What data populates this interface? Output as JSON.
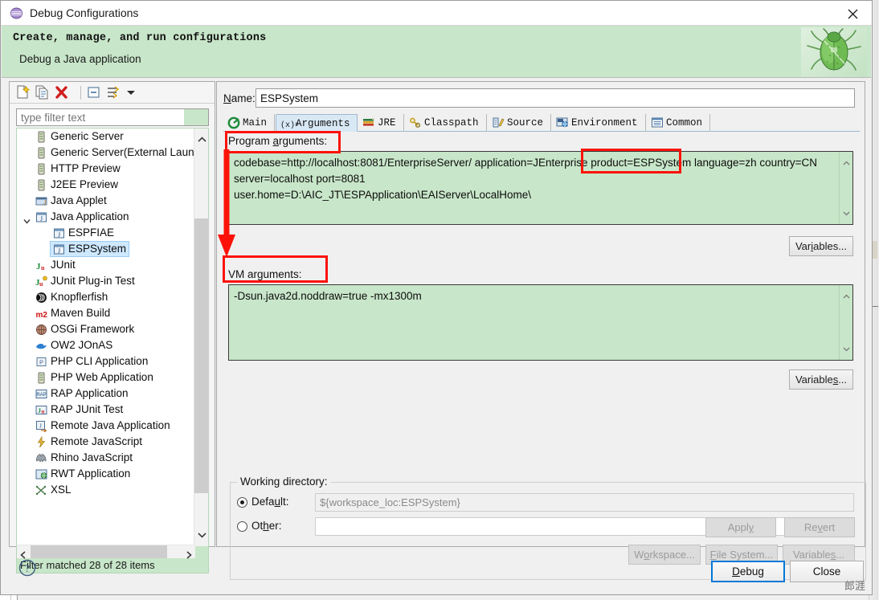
{
  "window": {
    "title": "Debug Configurations",
    "icon": "debug-configurations-icon",
    "close_label": "✕"
  },
  "header": {
    "title": "Create, manage, and run configurations",
    "subtitle": "Debug a Java application",
    "image": "green-bug-icon"
  },
  "left_panel": {
    "toolbar": [
      {
        "name": "new-launch-configuration-icon",
        "tooltip": "New launch configuration"
      },
      {
        "name": "duplicate-icon",
        "tooltip": "Duplicate"
      },
      {
        "name": "delete-icon",
        "tooltip": "Delete"
      },
      {
        "name": "collapse-all-icon",
        "tooltip": "Collapse All"
      },
      {
        "name": "filter-icon",
        "tooltip": "Filter"
      },
      {
        "name": "chevron-down-icon",
        "tooltip": "Menu"
      }
    ],
    "filter": {
      "value": "",
      "placeholder": "type filter text"
    },
    "tree": [
      {
        "label": "Generic Server",
        "icon": "server-icon",
        "level": 1,
        "selected": false,
        "expandable": false
      },
      {
        "label": "Generic Server(External Launch)",
        "icon": "server-icon",
        "level": 1,
        "selected": false,
        "expandable": false
      },
      {
        "label": "HTTP Preview",
        "icon": "server-icon",
        "level": 1,
        "selected": false,
        "expandable": false
      },
      {
        "label": "J2EE Preview",
        "icon": "server-icon",
        "level": 1,
        "selected": false,
        "expandable": false
      },
      {
        "label": "Java Applet",
        "icon": "java-applet-icon",
        "level": 1,
        "selected": false,
        "expandable": false
      },
      {
        "label": "Java Application",
        "icon": "java-application-icon",
        "level": 1,
        "selected": false,
        "expandable": true,
        "expanded": true
      },
      {
        "label": "ESPFIAE",
        "icon": "java-config-icon",
        "level": 2,
        "selected": false,
        "expandable": false
      },
      {
        "label": "ESPSystem",
        "icon": "java-config-icon",
        "level": 2,
        "selected": true,
        "expandable": false
      },
      {
        "label": "JUnit",
        "icon": "junit-icon",
        "level": 1,
        "selected": false,
        "expandable": false
      },
      {
        "label": "JUnit Plug-in Test",
        "icon": "junit-plugin-icon",
        "level": 1,
        "selected": false,
        "expandable": false
      },
      {
        "label": "Knopflerfish",
        "icon": "knopflerfish-icon",
        "level": 1,
        "selected": false,
        "expandable": false
      },
      {
        "label": "Maven Build",
        "icon": "maven-icon",
        "level": 1,
        "selected": false,
        "expandable": false
      },
      {
        "label": "OSGi Framework",
        "icon": "osgi-icon",
        "level": 1,
        "selected": false,
        "expandable": false
      },
      {
        "label": "OW2 JOnAS",
        "icon": "jonas-icon",
        "level": 1,
        "selected": false,
        "expandable": false
      },
      {
        "label": "PHP CLI Application",
        "icon": "php-cli-icon",
        "level": 1,
        "selected": false,
        "expandable": false
      },
      {
        "label": "PHP Web Application",
        "icon": "php-web-icon",
        "level": 1,
        "selected": false,
        "expandable": false
      },
      {
        "label": "RAP Application",
        "icon": "rap-icon",
        "level": 1,
        "selected": false,
        "expandable": false
      },
      {
        "label": "RAP JUnit Test",
        "icon": "rap-junit-icon",
        "level": 1,
        "selected": false,
        "expandable": false
      },
      {
        "label": "Remote Java Application",
        "icon": "remote-java-icon",
        "level": 1,
        "selected": false,
        "expandable": false
      },
      {
        "label": "Remote JavaScript",
        "icon": "remote-javascript-icon",
        "level": 1,
        "selected": false,
        "expandable": false
      },
      {
        "label": "Rhino JavaScript",
        "icon": "rhino-icon",
        "level": 1,
        "selected": false,
        "expandable": false
      },
      {
        "label": "RWT Application",
        "icon": "rwt-icon",
        "level": 1,
        "selected": false,
        "expandable": false
      },
      {
        "label": "XSL",
        "icon": "xsl-icon",
        "level": 1,
        "selected": false,
        "expandable": false
      }
    ],
    "status": "Filter matched 28 of 28 items"
  },
  "right_panel": {
    "name_label": "Name:",
    "name_value": "ESPSystem",
    "tabs": [
      {
        "label": "Main",
        "icon": "main-tab-icon",
        "active": false
      },
      {
        "label": "Arguments",
        "icon": "arguments-tab-icon",
        "active": true
      },
      {
        "label": "JRE",
        "icon": "jre-tab-icon",
        "active": false
      },
      {
        "label": "Classpath",
        "icon": "classpath-tab-icon",
        "active": false
      },
      {
        "label": "Source",
        "icon": "source-tab-icon",
        "active": false
      },
      {
        "label": "Environment",
        "icon": "environment-tab-icon",
        "active": false
      },
      {
        "label": "Common",
        "icon": "common-tab-icon",
        "active": false
      }
    ],
    "program_arguments": {
      "label": "Program arguments:",
      "value": "codebase=http://localhost:8081/EnterpriseServer/ application=JEnterprise product=ESPSystem language=zh country=CN\nserver=localhost port=8081\nuser.home=D:\\AIC_JT\\ESPApplication\\EAIServer\\LocalHome\\",
      "variables_button": "Variables..."
    },
    "vm_arguments": {
      "label": "VM arguments:",
      "value": "-Dsun.java2d.noddraw=true -mx1300m",
      "variables_button": "Variables..."
    },
    "working_directory": {
      "legend": "Working directory:",
      "default_label": "Default:",
      "default_value": "${workspace_loc:ESPSystem}",
      "default_selected": true,
      "other_label": "Other:",
      "other_value": "",
      "other_selected": false,
      "workspace_button": "Workspace...",
      "file_system_button": "File System...",
      "variables_button": "Variables..."
    },
    "apply_button": "Apply",
    "revert_button": "Revert"
  },
  "footer": {
    "help_icon": "help-icon",
    "debug_button": "Debug",
    "close_button": "Close",
    "watermark": "郎涯"
  },
  "colors": {
    "header_bg": "#c8e6c9",
    "annotation": "#fc1208",
    "selection": "#cde8ff",
    "active_tab": "#d8e8f5",
    "focus_border": "#0078d7"
  }
}
